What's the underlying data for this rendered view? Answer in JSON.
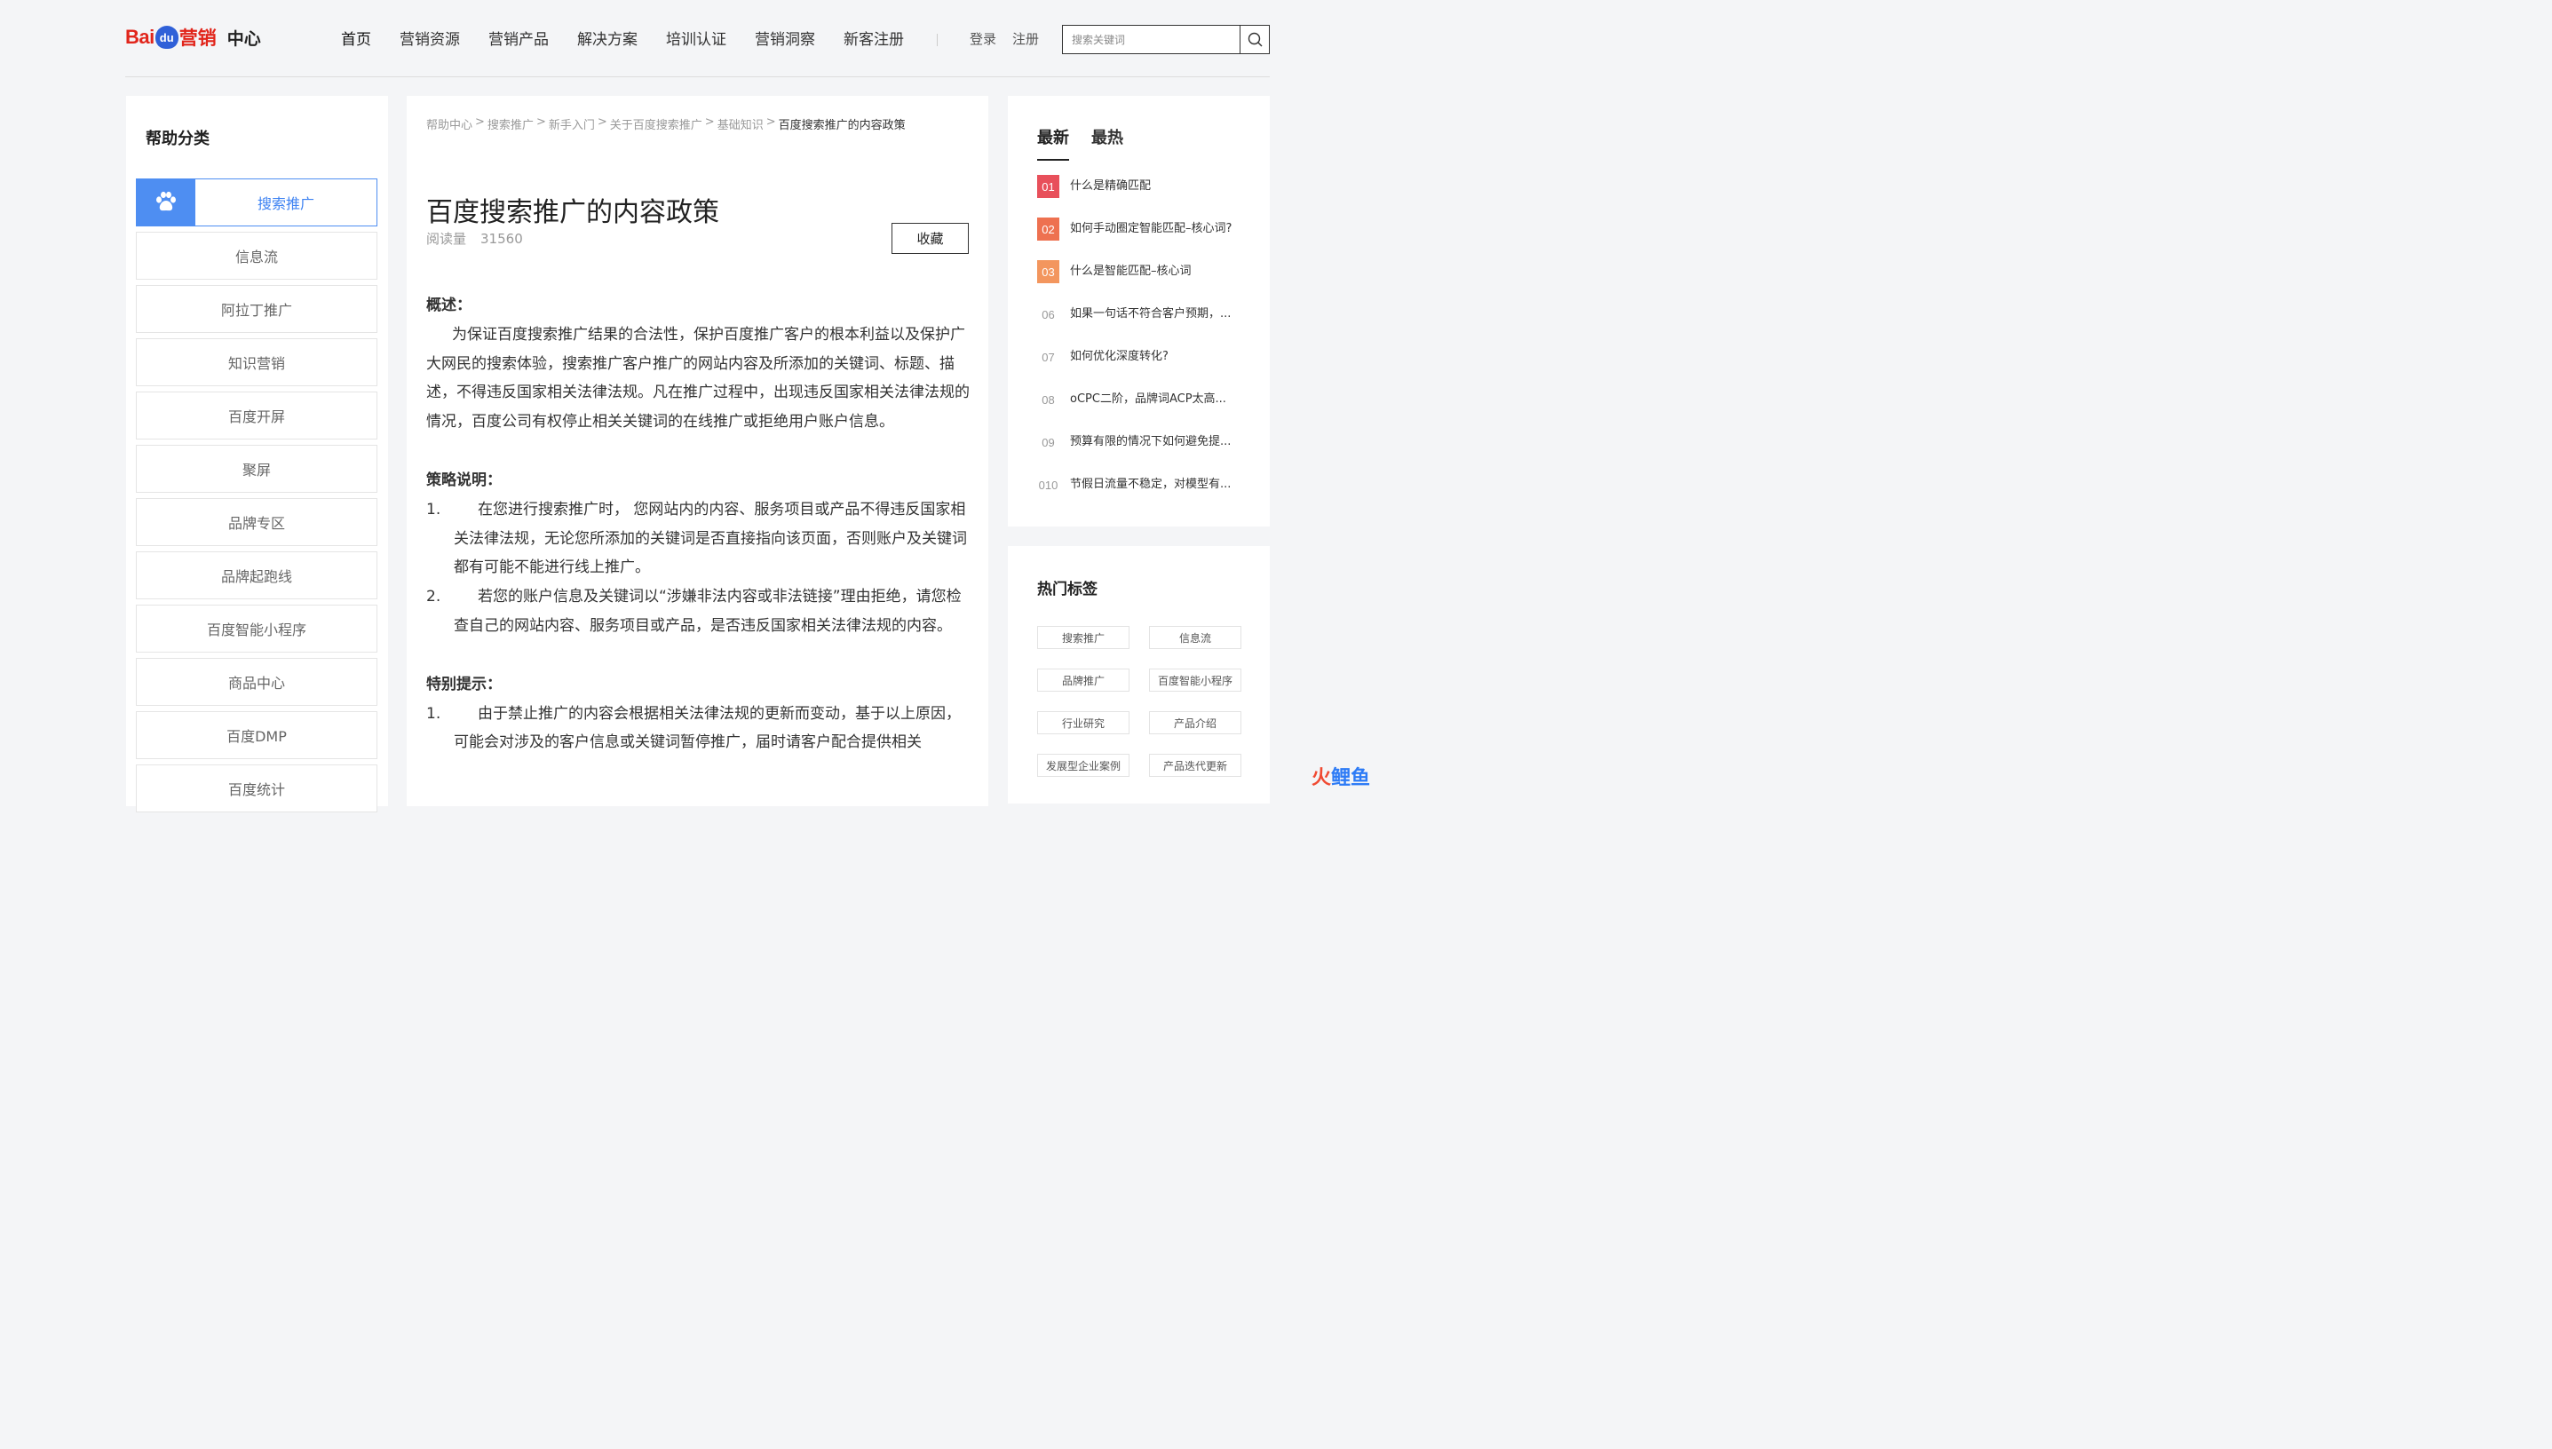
{
  "header": {
    "logo_bai": "Bai",
    "logo_du": "du",
    "logo_marketing": "营销",
    "logo_center": "中心",
    "nav": [
      "首页",
      "营销资源",
      "营销产品",
      "解决方案",
      "培训认证",
      "营销洞察",
      "新客注册"
    ],
    "login": "登录",
    "register": "注册",
    "search_placeholder": "搜索关键词"
  },
  "sidebar": {
    "title": "帮助分类",
    "items": [
      "搜索推广",
      "信息流",
      "阿拉丁推广",
      "知识营销",
      "百度开屏",
      "聚屏",
      "品牌专区",
      "品牌起跑线",
      "百度智能小程序",
      "商品中心",
      "百度DMP",
      "百度统计"
    ]
  },
  "article": {
    "breadcrumb": [
      "帮助中心",
      "搜索推广",
      "新手入门",
      "关于百度搜索推广",
      "基础知识",
      "百度搜索推广的内容政策"
    ],
    "title": "百度搜索推广的内容政策",
    "read_label": "阅读量",
    "read_count": "31560",
    "fav_label": "收藏",
    "overview_title": "概述：",
    "overview_text": "为保证百度搜索推广结果的合法性，保护百度推广客户的根本利益以及保护广大网民的搜索体验，搜索推广客户推广的网站内容及所添加的关键词、标题、描述，不得违反国家相关法律法规。凡在推广过程中，出现违反国家相关法律法规的情况，百度公司有权停止相关关键词的在线推广或拒绝用户账户信息。",
    "strategy_title": "策略说明：",
    "strategy_items": [
      {
        "num": "1.",
        "text": "在您进行搜索推广时， 您网站内的内容、服务项目或产品不得违反国家相关法律法规，无论您所添加的关键词是否直接指向该页面，否则账户及关键词都有可能不能进行线上推广。"
      },
      {
        "num": "2.",
        "text": "若您的账户信息及关键词以“涉嫌非法内容或非法链接”理由拒绝，请您检查自己的网站内容、服务项目或产品，是否违反国家相关法律法规的内容。"
      }
    ],
    "tips_title": "特别提示：",
    "tips_items": [
      {
        "num": "1.",
        "text": "由于禁止推广的内容会根据相关法律法规的更新而变动，基于以上原因，可能会对涉及的客户信息或关键词暂停推广，届时请客户配合提供相关"
      }
    ]
  },
  "latest": {
    "tabs": [
      "最新",
      "最热"
    ],
    "items": [
      {
        "num": "01",
        "text": "什么是精确匹配",
        "color": "#e8505b"
      },
      {
        "num": "02",
        "text": "如何手动圈定智能匹配–核心词?",
        "color": "#ee7150"
      },
      {
        "num": "03",
        "text": "什么是智能匹配–核心词",
        "color": "#f3965e"
      },
      {
        "num": "06",
        "text": "如果一句话不符合客户预期，...",
        "color": ""
      },
      {
        "num": "07",
        "text": "如何优化深度转化?",
        "color": ""
      },
      {
        "num": "08",
        "text": "oCPC二阶，品牌词ACP太高...",
        "color": ""
      },
      {
        "num": "09",
        "text": "预算有限的情况下如何避免提...",
        "color": ""
      },
      {
        "num": "010",
        "text": "节假日流量不稳定，对模型有...",
        "color": ""
      }
    ]
  },
  "hot_tags": {
    "title": "热门标签",
    "tags": [
      "搜索推广",
      "信息流",
      "品牌推广",
      "百度智能小程序",
      "行业研究",
      "产品介绍",
      "发展型企业案例",
      "产品迭代更新"
    ]
  },
  "watermark": {
    "part1": "火",
    "part2": "鲤鱼"
  },
  "colors": {
    "accent": "#4e8ef2",
    "brand_red": "#e1251b",
    "brand_blue": "#2f60d8"
  }
}
